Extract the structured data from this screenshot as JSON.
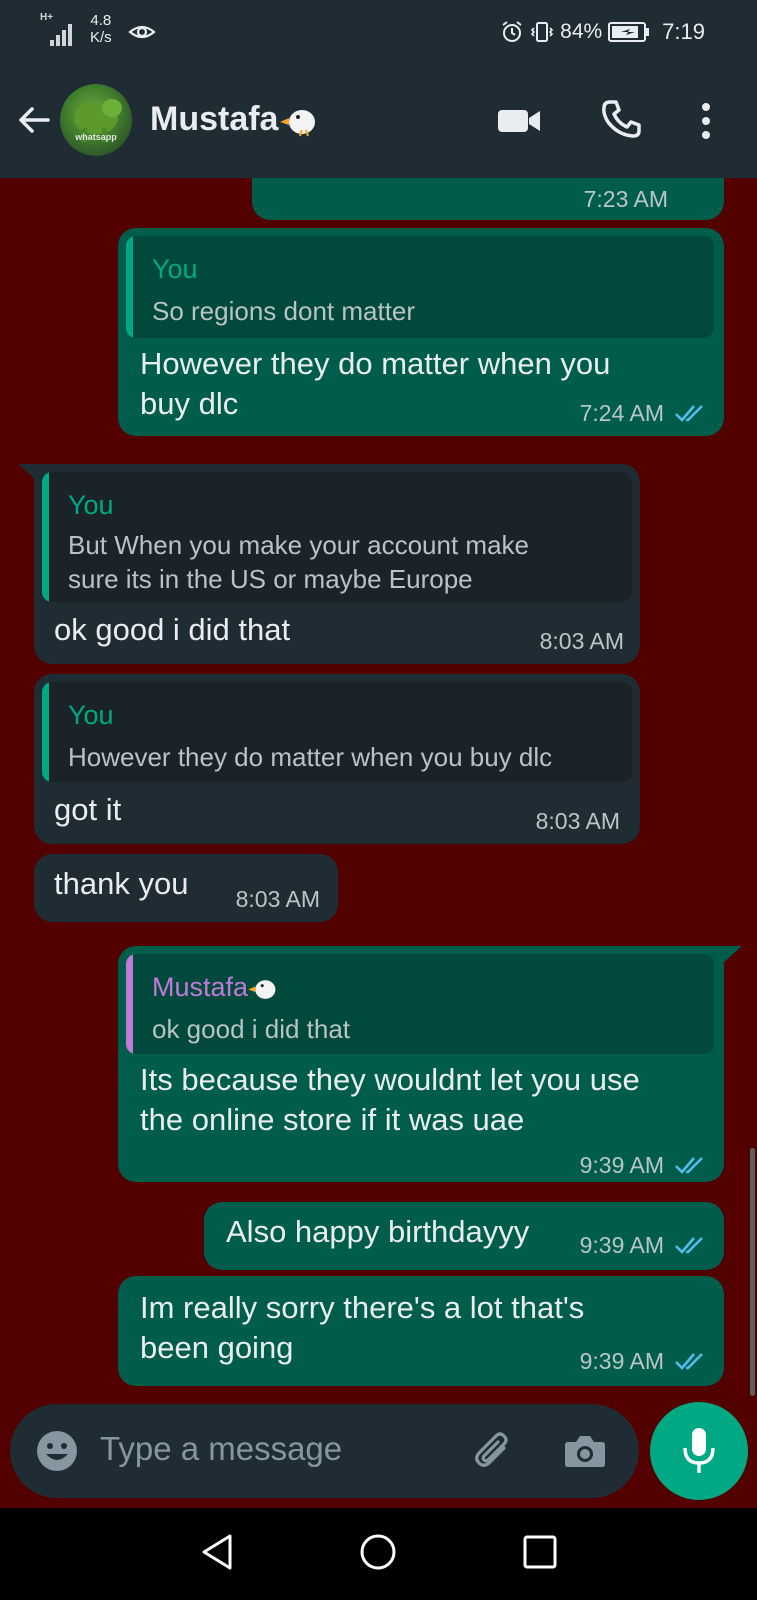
{
  "status_bar": {
    "network_type": "H+",
    "net_speed_value": "4.8",
    "net_speed_unit": "K/s",
    "battery_percent": "84%",
    "time": "7:19"
  },
  "header": {
    "contact_name": "Mustafa",
    "avatar_caption": "whatsapp"
  },
  "messages": [
    {
      "time": "7:23 AM"
    },
    {
      "quote_author": "You",
      "quote_text": "So regions dont matter",
      "text_line1": "However they do matter when you",
      "text_line2": "buy dlc",
      "time": "7:24 AM"
    },
    {
      "quote_author": "You",
      "quote_text_line1": "But When you make your account make",
      "quote_text_line2": "sure its in the US or maybe Europe",
      "text": "ok good i did that",
      "time": "8:03 AM"
    },
    {
      "quote_author": "You",
      "quote_text": "However they do matter when you buy dlc",
      "text": "got it",
      "time": "8:03 AM"
    },
    {
      "text": "thank you",
      "time": "8:03 AM"
    },
    {
      "quote_author": "Mustafa",
      "quote_text": "ok good i did that",
      "text_line1": "Its because they wouldnt let you use",
      "text_line2": "the online store if it was uae",
      "time": "9:39 AM"
    },
    {
      "text": "Also happy birthdayyy",
      "time": "9:39 AM"
    },
    {
      "text_line1": "Im really sorry there's a lot that's",
      "text_line2": "been going",
      "time": "9:39 AM"
    }
  ],
  "composer": {
    "placeholder": "Type a message"
  },
  "colors": {
    "wallpaper": "#520000",
    "outgoing_bubble": "#005c4b",
    "incoming_bubble": "#202c33",
    "accent": "#00a884",
    "read_ticks": "#53bdeb"
  },
  "icons": [
    "back-arrow-icon",
    "video-call-icon",
    "voice-call-icon",
    "more-options-icon",
    "emoji-icon",
    "attach-icon",
    "camera-icon",
    "mic-icon",
    "double-check-icon"
  ]
}
